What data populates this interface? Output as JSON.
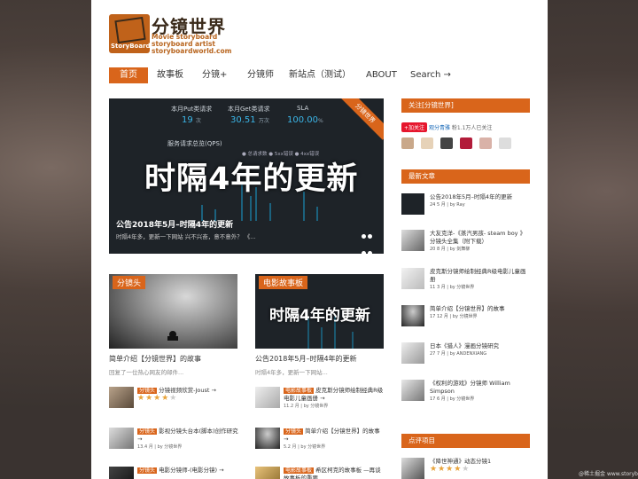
{
  "header": {
    "site_title": "分镜世界",
    "logo_badge": "StoryBoard",
    "tagline_lines": [
      "Movie storyboard",
      "storyboard artist",
      "storyboardworld.com"
    ]
  },
  "nav": [
    "首页",
    "故事板",
    "分镜+",
    "分镜师",
    "新站点（测试）",
    "ABOUT",
    "Search →"
  ],
  "hero": {
    "stats": [
      {
        "label": "本月Put类请求",
        "value": "19",
        "unit": "次"
      },
      {
        "label": "本月Get类请求",
        "value": "30.51",
        "unit": "万次"
      },
      {
        "label": "SLA",
        "value": "100.00",
        "unit": "%"
      }
    ],
    "qps_label": "服务请求总览(QPS)",
    "legend": "● 总请求数  ● 5xx错误  ● 4xx错误",
    "overlay_text": "时隔4年的更新",
    "ribbon": "分镜世界",
    "caption": "公告2018年5月–时隔4年的更新",
    "caption_sub": "时隔4年多，更新一下网站 兴不兴奋，意不意外？ 《..."
  },
  "cards": [
    {
      "tag": "分镜头",
      "title": "简单介绍【分镜世界】的故事",
      "excerpt": "回复了一位热心网友的邮件..."
    },
    {
      "tag": "电影故事板",
      "title": "公告2018年5月–时隔4年的更新",
      "excerpt": "时隔4年多，更新一下网站..."
    }
  ],
  "left_minis": [
    {
      "tag": "分镜头",
      "title": "分镜视频欣赏-Joust →",
      "meta": "",
      "rating": 4
    },
    {
      "tag": "分镜头",
      "title": "影视分镜头台本(脚本)创作研究 →",
      "meta": "13.4 月 | by 分镜世界",
      "rating": null
    },
    {
      "tag": "分镜头",
      "title": "电影分镜师-(电影分镜) →",
      "meta": "",
      "rating": null
    }
  ],
  "right_minis": [
    {
      "tag": "电影故事板",
      "title": "皮克斯分镜师绘制经典R级电影儿童画册 →",
      "meta": "11.2 月 | by 分镜世界"
    },
    {
      "tag": "分镜头",
      "title": "简单介绍【分镜世界】的故事 →",
      "meta": "5.2 月 | by 分镜世界"
    },
    {
      "tag": "电影故事板",
      "title": "希区柯克的故事板 —再谈故事板的重要",
      "meta": ""
    }
  ],
  "sidebar": {
    "follow_head": "关注[分镜世界]",
    "weibo_btn": "+加关注",
    "weibo_name": "观分青雅",
    "weibo_fans": "粉1.1万人已关注",
    "latest_head": "最新文章",
    "articles": [
      {
        "title": "公告2018年5月–时隔4年的更新",
        "meta": "24 5 月 | by Ray"
      },
      {
        "title": "大友克洋-《蒸汽男孩- steam boy 》分镜头全集（附下载）",
        "meta": "20 8 月 | by 剑舞柳"
      },
      {
        "title": "皮克斯分镜师绘制经典R级电影儿童画册",
        "meta": "11 3 月 | by 分镜世界"
      },
      {
        "title": "简单介绍【分镜世界】的故事",
        "meta": "17 12 月 | by 分镜世界"
      },
      {
        "title": "日本《猎人》漫画分镜研究",
        "meta": "27 7 月 | by ANDENXIANG"
      },
      {
        "title": "《权利的游戏》分镜师 William Simpson",
        "meta": "17 6 月 | by 分镜世界"
      }
    ],
    "review_head": "点评项目",
    "review": {
      "title": "《降世神通》动态分镜1",
      "rating": 4
    }
  },
  "watermark": "@稀土掘金 www.storyb"
}
